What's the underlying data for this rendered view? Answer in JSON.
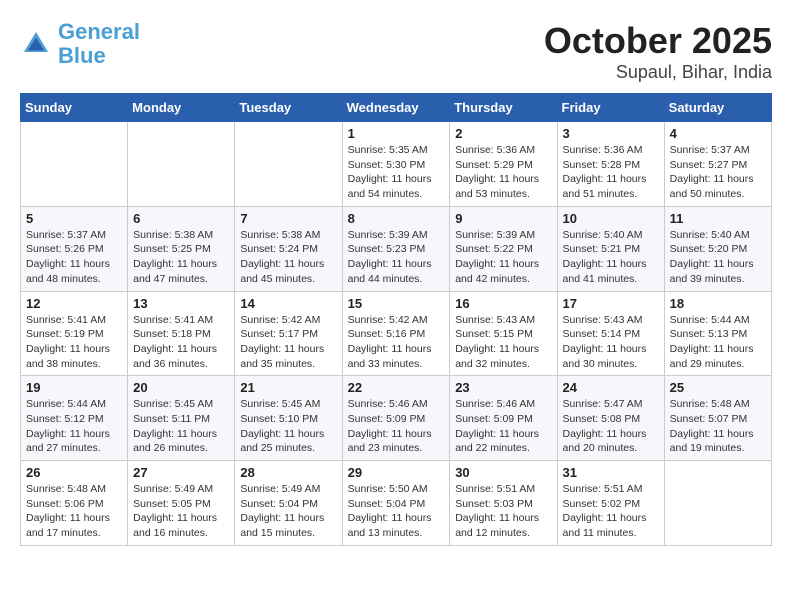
{
  "header": {
    "logo_line1": "General",
    "logo_line2": "Blue",
    "title": "October 2025",
    "subtitle": "Supaul, Bihar, India"
  },
  "weekdays": [
    "Sunday",
    "Monday",
    "Tuesday",
    "Wednesday",
    "Thursday",
    "Friday",
    "Saturday"
  ],
  "weeks": [
    [
      {
        "day": "",
        "sunrise": "",
        "sunset": "",
        "daylight": ""
      },
      {
        "day": "",
        "sunrise": "",
        "sunset": "",
        "daylight": ""
      },
      {
        "day": "",
        "sunrise": "",
        "sunset": "",
        "daylight": ""
      },
      {
        "day": "1",
        "sunrise": "Sunrise: 5:35 AM",
        "sunset": "Sunset: 5:30 PM",
        "daylight": "Daylight: 11 hours and 54 minutes."
      },
      {
        "day": "2",
        "sunrise": "Sunrise: 5:36 AM",
        "sunset": "Sunset: 5:29 PM",
        "daylight": "Daylight: 11 hours and 53 minutes."
      },
      {
        "day": "3",
        "sunrise": "Sunrise: 5:36 AM",
        "sunset": "Sunset: 5:28 PM",
        "daylight": "Daylight: 11 hours and 51 minutes."
      },
      {
        "day": "4",
        "sunrise": "Sunrise: 5:37 AM",
        "sunset": "Sunset: 5:27 PM",
        "daylight": "Daylight: 11 hours and 50 minutes."
      }
    ],
    [
      {
        "day": "5",
        "sunrise": "Sunrise: 5:37 AM",
        "sunset": "Sunset: 5:26 PM",
        "daylight": "Daylight: 11 hours and 48 minutes."
      },
      {
        "day": "6",
        "sunrise": "Sunrise: 5:38 AM",
        "sunset": "Sunset: 5:25 PM",
        "daylight": "Daylight: 11 hours and 47 minutes."
      },
      {
        "day": "7",
        "sunrise": "Sunrise: 5:38 AM",
        "sunset": "Sunset: 5:24 PM",
        "daylight": "Daylight: 11 hours and 45 minutes."
      },
      {
        "day": "8",
        "sunrise": "Sunrise: 5:39 AM",
        "sunset": "Sunset: 5:23 PM",
        "daylight": "Daylight: 11 hours and 44 minutes."
      },
      {
        "day": "9",
        "sunrise": "Sunrise: 5:39 AM",
        "sunset": "Sunset: 5:22 PM",
        "daylight": "Daylight: 11 hours and 42 minutes."
      },
      {
        "day": "10",
        "sunrise": "Sunrise: 5:40 AM",
        "sunset": "Sunset: 5:21 PM",
        "daylight": "Daylight: 11 hours and 41 minutes."
      },
      {
        "day": "11",
        "sunrise": "Sunrise: 5:40 AM",
        "sunset": "Sunset: 5:20 PM",
        "daylight": "Daylight: 11 hours and 39 minutes."
      }
    ],
    [
      {
        "day": "12",
        "sunrise": "Sunrise: 5:41 AM",
        "sunset": "Sunset: 5:19 PM",
        "daylight": "Daylight: 11 hours and 38 minutes."
      },
      {
        "day": "13",
        "sunrise": "Sunrise: 5:41 AM",
        "sunset": "Sunset: 5:18 PM",
        "daylight": "Daylight: 11 hours and 36 minutes."
      },
      {
        "day": "14",
        "sunrise": "Sunrise: 5:42 AM",
        "sunset": "Sunset: 5:17 PM",
        "daylight": "Daylight: 11 hours and 35 minutes."
      },
      {
        "day": "15",
        "sunrise": "Sunrise: 5:42 AM",
        "sunset": "Sunset: 5:16 PM",
        "daylight": "Daylight: 11 hours and 33 minutes."
      },
      {
        "day": "16",
        "sunrise": "Sunrise: 5:43 AM",
        "sunset": "Sunset: 5:15 PM",
        "daylight": "Daylight: 11 hours and 32 minutes."
      },
      {
        "day": "17",
        "sunrise": "Sunrise: 5:43 AM",
        "sunset": "Sunset: 5:14 PM",
        "daylight": "Daylight: 11 hours and 30 minutes."
      },
      {
        "day": "18",
        "sunrise": "Sunrise: 5:44 AM",
        "sunset": "Sunset: 5:13 PM",
        "daylight": "Daylight: 11 hours and 29 minutes."
      }
    ],
    [
      {
        "day": "19",
        "sunrise": "Sunrise: 5:44 AM",
        "sunset": "Sunset: 5:12 PM",
        "daylight": "Daylight: 11 hours and 27 minutes."
      },
      {
        "day": "20",
        "sunrise": "Sunrise: 5:45 AM",
        "sunset": "Sunset: 5:11 PM",
        "daylight": "Daylight: 11 hours and 26 minutes."
      },
      {
        "day": "21",
        "sunrise": "Sunrise: 5:45 AM",
        "sunset": "Sunset: 5:10 PM",
        "daylight": "Daylight: 11 hours and 25 minutes."
      },
      {
        "day": "22",
        "sunrise": "Sunrise: 5:46 AM",
        "sunset": "Sunset: 5:09 PM",
        "daylight": "Daylight: 11 hours and 23 minutes."
      },
      {
        "day": "23",
        "sunrise": "Sunrise: 5:46 AM",
        "sunset": "Sunset: 5:09 PM",
        "daylight": "Daylight: 11 hours and 22 minutes."
      },
      {
        "day": "24",
        "sunrise": "Sunrise: 5:47 AM",
        "sunset": "Sunset: 5:08 PM",
        "daylight": "Daylight: 11 hours and 20 minutes."
      },
      {
        "day": "25",
        "sunrise": "Sunrise: 5:48 AM",
        "sunset": "Sunset: 5:07 PM",
        "daylight": "Daylight: 11 hours and 19 minutes."
      }
    ],
    [
      {
        "day": "26",
        "sunrise": "Sunrise: 5:48 AM",
        "sunset": "Sunset: 5:06 PM",
        "daylight": "Daylight: 11 hours and 17 minutes."
      },
      {
        "day": "27",
        "sunrise": "Sunrise: 5:49 AM",
        "sunset": "Sunset: 5:05 PM",
        "daylight": "Daylight: 11 hours and 16 minutes."
      },
      {
        "day": "28",
        "sunrise": "Sunrise: 5:49 AM",
        "sunset": "Sunset: 5:04 PM",
        "daylight": "Daylight: 11 hours and 15 minutes."
      },
      {
        "day": "29",
        "sunrise": "Sunrise: 5:50 AM",
        "sunset": "Sunset: 5:04 PM",
        "daylight": "Daylight: 11 hours and 13 minutes."
      },
      {
        "day": "30",
        "sunrise": "Sunrise: 5:51 AM",
        "sunset": "Sunset: 5:03 PM",
        "daylight": "Daylight: 11 hours and 12 minutes."
      },
      {
        "day": "31",
        "sunrise": "Sunrise: 5:51 AM",
        "sunset": "Sunset: 5:02 PM",
        "daylight": "Daylight: 11 hours and 11 minutes."
      },
      {
        "day": "",
        "sunrise": "",
        "sunset": "",
        "daylight": ""
      }
    ]
  ]
}
